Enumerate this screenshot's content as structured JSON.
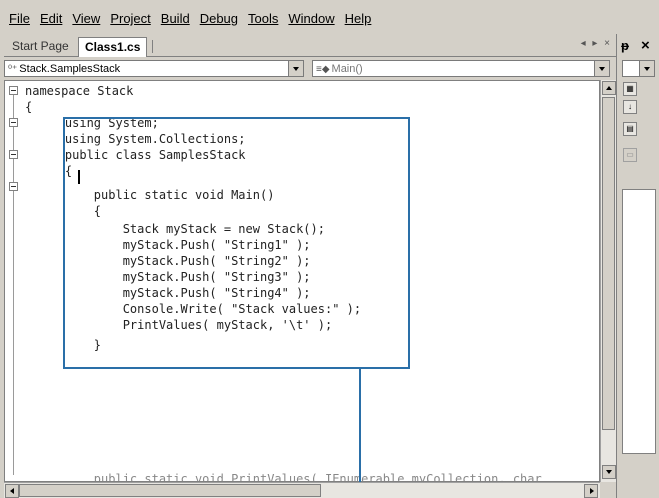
{
  "menu": {
    "items": [
      {
        "label": "File",
        "mnemonic": "F"
      },
      {
        "label": "Edit",
        "mnemonic": "E"
      },
      {
        "label": "View",
        "mnemonic": "V"
      },
      {
        "label": "Project",
        "mnemonic": "P"
      },
      {
        "label": "Build",
        "mnemonic": "B"
      },
      {
        "label": "Debug",
        "mnemonic": "D"
      },
      {
        "label": "Tools",
        "mnemonic": "T"
      },
      {
        "label": "Window",
        "mnemonic": "W"
      },
      {
        "label": "Help",
        "mnemonic": "H"
      }
    ]
  },
  "tabs": {
    "start_page": "Start Page",
    "active": "Class1.cs",
    "controls": "◂ ▸ ×"
  },
  "navbar": {
    "type_combo": "Stack.SamplesStack",
    "member_combo": "Main()"
  },
  "code": {
    "lines": [
      "namespace Stack",
      "{",
      "    using System;",
      "    using System.Collections;",
      "    public class SamplesStack",
      "    {",
      "        public static void Main()",
      "        {",
      "            Stack myStack = new Stack();",
      "            myStack.Push( \"String1\" );",
      "            myStack.Push( \"String2\" );",
      "            myStack.Push( \"String3\" );",
      "            myStack.Push( \"String4\" );",
      "            Console.Write( \"Stack values:\" );",
      "            PrintValues( myStack, '\\t' );",
      "        }",
      "        public static void PrintValues( IEnumerable myCollection, char"
    ]
  },
  "right_panel": {
    "pin": "ᵽ",
    "close": "×"
  },
  "colors": {
    "chrome": "#d4d0c8",
    "callout": "#2a6fa8",
    "editor_bg": "#ffffff"
  },
  "icons": [
    "menu-mnemonic",
    "class-icon",
    "method-icon",
    "categorized-icon",
    "alphabetical-icon",
    "properties-icon",
    "pages-icon",
    "pin-icon",
    "close-icon"
  ]
}
